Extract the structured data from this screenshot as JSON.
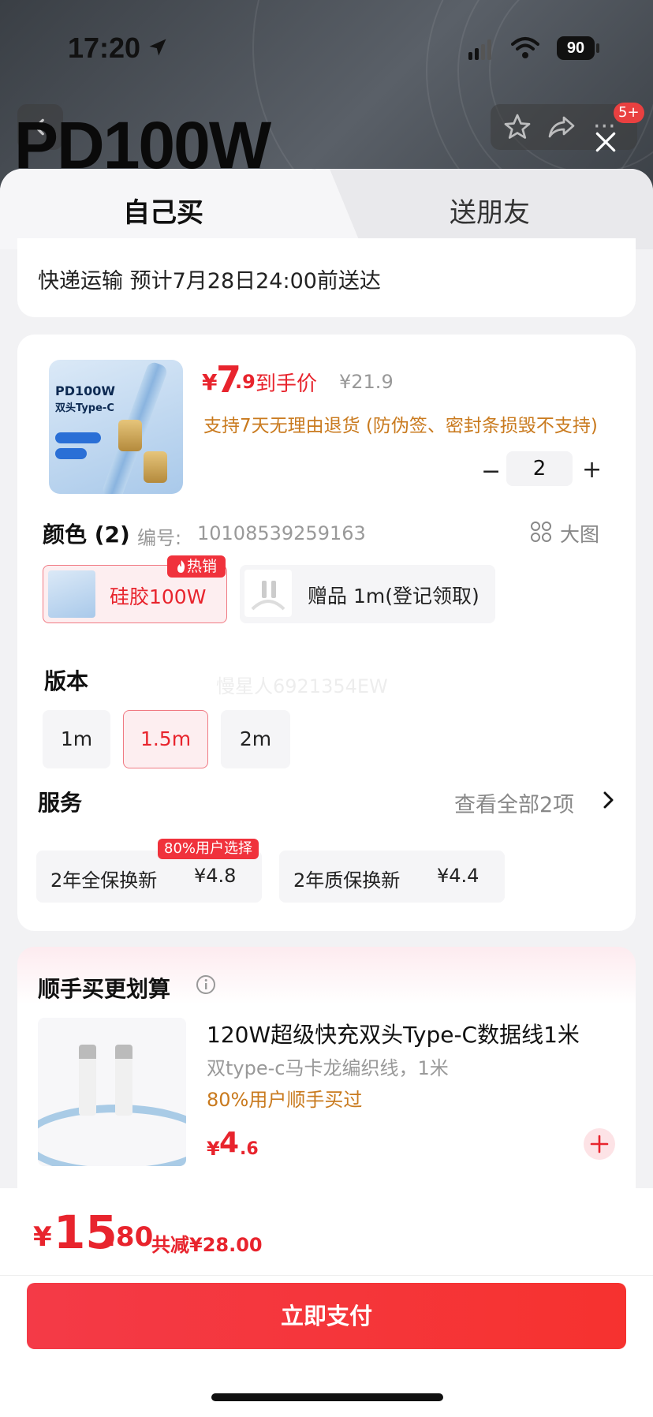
{
  "status_bar": {
    "time": "17:20",
    "battery": "90"
  },
  "header": {
    "hero_text": "PD100W",
    "notif_badge": "5+"
  },
  "tabs": [
    {
      "label": "自己买"
    },
    {
      "label": "送朋友"
    }
  ],
  "delivery": {
    "text": "快递运输 预计7月28日24:00前送达"
  },
  "product": {
    "image_title": "PD100W",
    "image_subtitle": "双头Type-C",
    "price_currency": "¥",
    "price_integer": "7",
    "price_decimal": ".9",
    "price_tag": "到手价",
    "original_price": "¥21.9",
    "return_policy": "支持7天无理由退货 (防伪签、密封条损毁不支持)",
    "quantity": "2",
    "qty_minus": "−",
    "qty_plus": "+"
  },
  "color_section": {
    "label": "颜色 (2)",
    "sku_label": "编号:",
    "sku_value": "10108539259163",
    "big_pic_label": "大图",
    "options": [
      {
        "label": "硅胶100W",
        "badge": "热销",
        "selected": true
      },
      {
        "label": "赠品 1m(登记领取)",
        "selected": false
      }
    ]
  },
  "version_section": {
    "label": "版本",
    "watermark": "慢星人6921354EW",
    "options": [
      {
        "label": "1m",
        "selected": false
      },
      {
        "label": "1.5m",
        "selected": true
      },
      {
        "label": "2m",
        "selected": false
      }
    ]
  },
  "service_section": {
    "label": "服务",
    "view_all": "查看全部2项",
    "items": [
      {
        "name": "2年全保换新",
        "price": "¥4.8",
        "badge": "80%用户选择"
      },
      {
        "name": "2年质保换新",
        "price": "¥4.4"
      }
    ]
  },
  "addon": {
    "title": "顺手买更划算",
    "name": "120W超级快充双头Type-C数据线1米",
    "subtitle": "双type-c马卡龙编织线，1米",
    "tip": "80%用户顺手买过",
    "price_currency": "¥",
    "price_integer": "4",
    "price_decimal": ".6"
  },
  "footer": {
    "total_currency": "¥",
    "total_integer": "15",
    "total_decimal": ".80",
    "total_saving": "共减¥28.00",
    "pay_button": "立即支付"
  },
  "colors": {
    "accent_red": "#e8242d",
    "policy_orange": "#c97a1e"
  },
  "icons": [
    "location-arrow-icon",
    "signal-icon",
    "wifi-icon",
    "back-icon",
    "star-icon",
    "share-icon",
    "more-icon",
    "close-icon",
    "fire-icon",
    "grid-icon",
    "chevron-right-icon",
    "info-icon",
    "plus-icon"
  ]
}
